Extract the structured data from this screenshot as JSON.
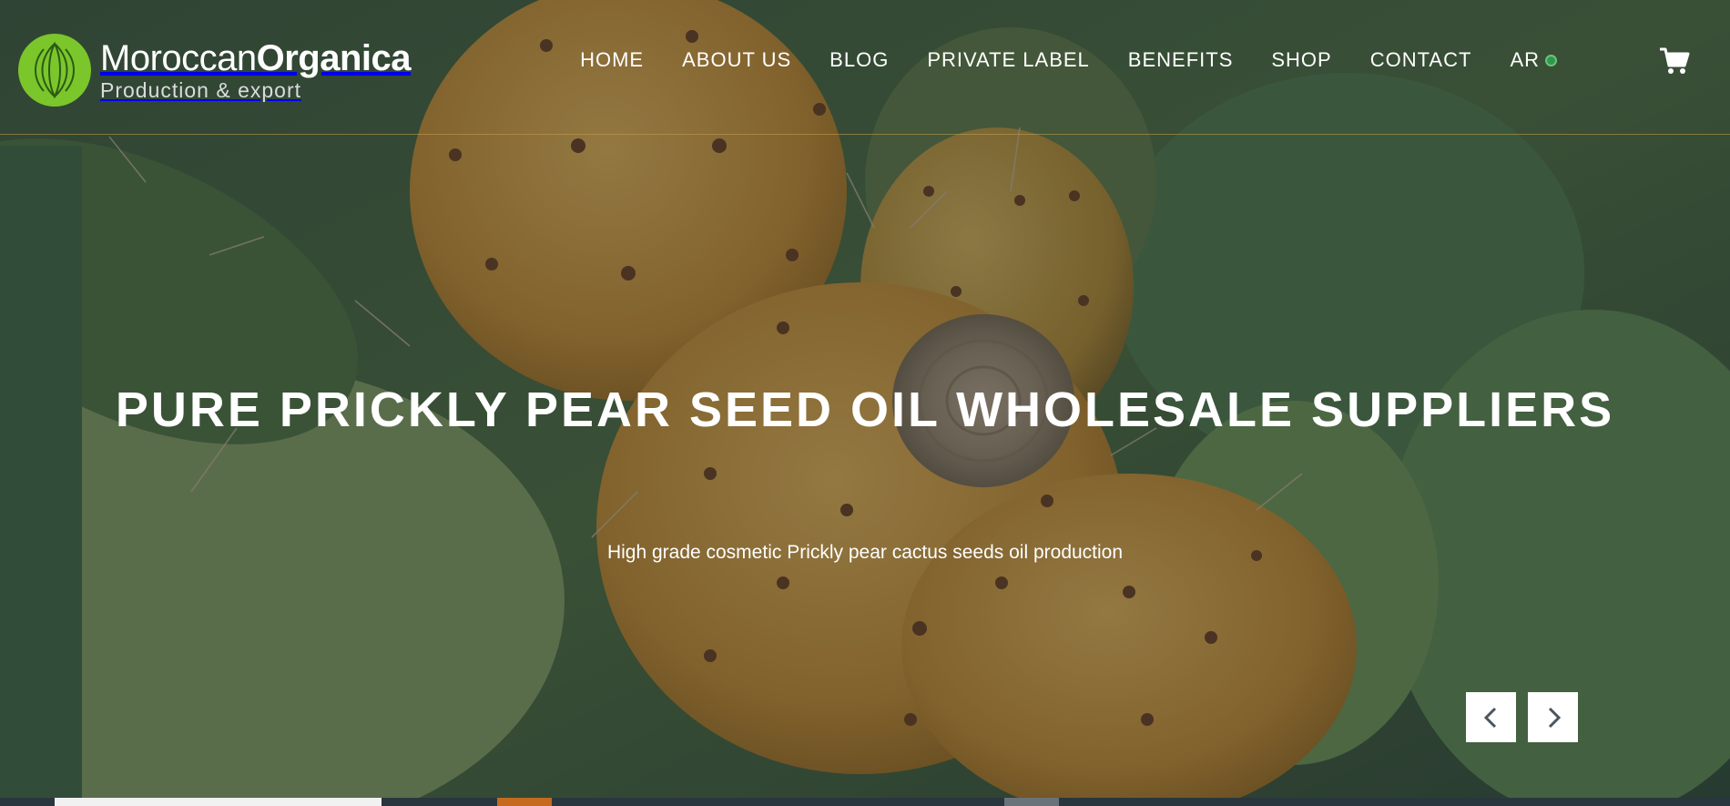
{
  "brand": {
    "name_light": "Moroccan",
    "name_bold": "Organica",
    "tagline": "Production & export",
    "accent_color": "#7bc62a"
  },
  "nav": {
    "items": [
      {
        "label": "HOME"
      },
      {
        "label": "ABOUT US"
      },
      {
        "label": "BLOG"
      },
      {
        "label": "PRIVATE LABEL"
      },
      {
        "label": "BENEFITS"
      },
      {
        "label": "SHOP"
      },
      {
        "label": "CONTACT"
      }
    ],
    "language": "AR",
    "language_icon": "flag-dot-icon",
    "cart_icon": "shopping-cart-icon"
  },
  "hero": {
    "title": "PURE PRICKLY PEAR SEED OIL WHOLESALE SUPPLIERS",
    "subtitle": "High grade cosmetic Prickly pear cactus seeds oil production",
    "prev_icon": "chevron-left-icon",
    "next_icon": "chevron-right-icon"
  },
  "colors": {
    "line_accent": "#c4a050",
    "strip_orange": "#c56a1e"
  }
}
